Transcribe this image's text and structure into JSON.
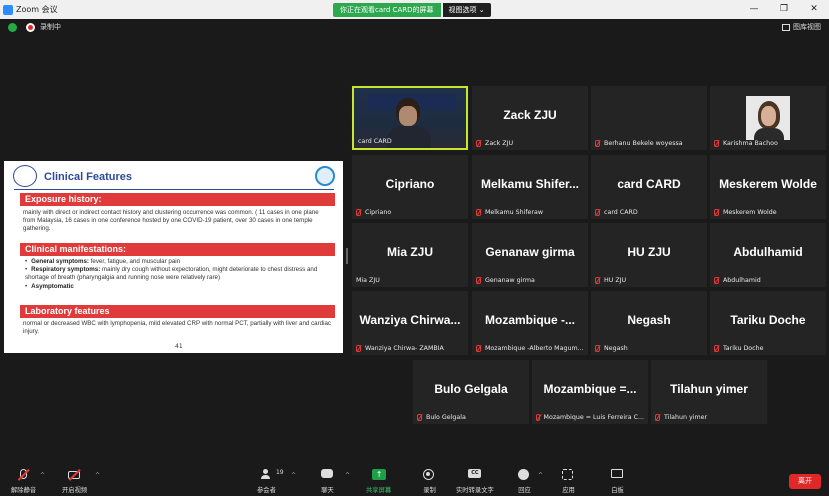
{
  "window": {
    "title": "Zoom 会议",
    "share_banner": "你正在观看card CARD的屏幕",
    "view_options": "视图选项",
    "recording_label": "录制中",
    "view_toggle": "图库视图"
  },
  "slide": {
    "title": "Clinical Features",
    "sections": [
      {
        "header": "Exposure history:",
        "body": "mainly with direct or indirect contact history and clustering occurrence was common. ( 11 cases in one plane from Malaysia, 16 cases in one conference hosted by one COVID-19 patient, over 30 cases in one temple gathering."
      },
      {
        "header": "Clinical manifestations:",
        "bullets": [
          {
            "bold": "General symptoms:",
            "text": " fever, fatigue, and muscular pain"
          },
          {
            "bold": "Respiratory symptoms:",
            "text": " mainly dry cough without expectoration, might deteriorate to chest distress and shortage of breath (pharyngalgia and running nose were relatively rare)"
          },
          {
            "bold": "Asymptomatic",
            "text": ""
          }
        ]
      },
      {
        "header": "Laboratory features",
        "body": "normal or decreased WBC with lymphopenia, mild elevated CRP with normal PCT, partially with liver and cardiac injury."
      }
    ],
    "page_number": "41"
  },
  "participants": [
    {
      "name": "",
      "label": "card CARD",
      "video": true,
      "active": true,
      "muted": false
    },
    {
      "name": "Zack ZJU",
      "label": "Zack ZJU",
      "muted": true
    },
    {
      "name": "",
      "label": "Berhanu Bekele woyessa",
      "muted": true
    },
    {
      "name": "",
      "label": "Karishma Bachoo",
      "muted": true,
      "photo": true
    },
    {
      "name": "Cipriano",
      "label": "Cipriano",
      "muted": true
    },
    {
      "name": "Melkamu  Shifer...",
      "label": "Melkamu Shiferaw",
      "muted": true
    },
    {
      "name": "card CARD",
      "label": "card CARD",
      "muted": true
    },
    {
      "name": "Meskerem Wolde",
      "label": "Meskerem Wolde",
      "muted": true
    },
    {
      "name": "Mia ZJU",
      "label": "Mia ZJU",
      "muted": false
    },
    {
      "name": "Genanaw girma",
      "label": "Genanaw girma",
      "muted": true
    },
    {
      "name": "HU ZJU",
      "label": "HU ZJU",
      "muted": true
    },
    {
      "name": "Abdulhamid",
      "label": "Abdulhamid",
      "muted": true
    },
    {
      "name": "Wanziya  Chirwa...",
      "label": "Wanziya Chirwa- ZAMBIA",
      "muted": true
    },
    {
      "name": "Mozambique  -...",
      "label": "Mozambique -Alberto Magum...",
      "muted": true
    },
    {
      "name": "Negash",
      "label": "Negash",
      "muted": true
    },
    {
      "name": "Tariku Doche",
      "label": "Tariku Doche",
      "muted": true
    },
    {
      "name": "Bulo Gelgala",
      "label": "Bulo Gelgala",
      "muted": true
    },
    {
      "name": "Mozambique  =...",
      "label": "Mozambique = Luis Ferreira C...",
      "muted": true
    },
    {
      "name": "Tilahun yimer",
      "label": "Tilahun yimer",
      "muted": true
    }
  ],
  "toolbar": {
    "unmute": "解除静音",
    "start_video": "开启视频",
    "participants": "参会者",
    "participants_count": "19",
    "chat": "聊天",
    "share_screen": "共享屏幕",
    "record": "录制",
    "live_transcript": "实时转录文字",
    "cc_label": "CC",
    "reactions": "回应",
    "apps": "应用",
    "whiteboard": "白板",
    "leave": "离开"
  },
  "colors": {
    "accent_green": "#1ea049",
    "slide_header_red": "#e03a3a",
    "slide_title_blue": "#2a4a9a",
    "leave_red": "#e02828",
    "active_speaker": "#c8e62a"
  }
}
